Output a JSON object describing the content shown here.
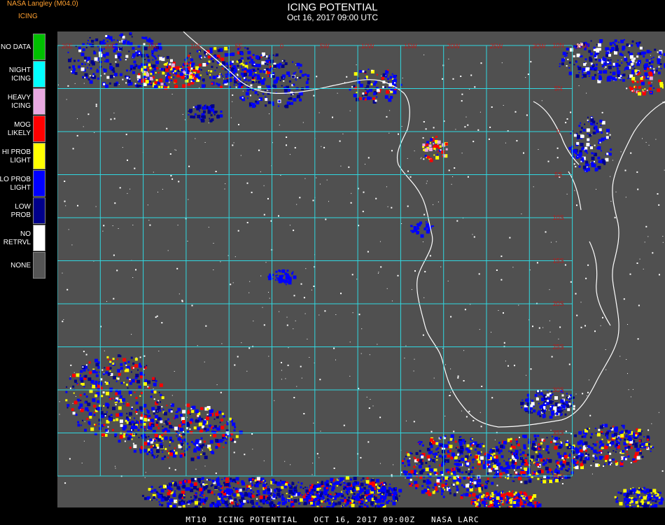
{
  "header": {
    "brand": "NASA Langley (M04.0)",
    "product_short": "ICING",
    "title": "ICING POTENTIAL",
    "subtitle": "Oct 16, 2017 09:00 UTC"
  },
  "legend": [
    {
      "label_lines": [
        "NO DATA"
      ],
      "color": "#00c000"
    },
    {
      "label_lines": [
        "NIGHT",
        "ICING"
      ],
      "color": "#00ffff"
    },
    {
      "label_lines": [
        "HEAVY",
        "ICING"
      ],
      "color": "#e8a8e0"
    },
    {
      "label_lines": [
        "MOG",
        "LIKELY"
      ],
      "color": "#ff0000"
    },
    {
      "label_lines": [
        "HI PROB",
        "LIGHT"
      ],
      "color": "#ffff00"
    },
    {
      "label_lines": [
        "LO PROB",
        "LIGHT"
      ],
      "color": "#0000ff"
    },
    {
      "label_lines": [
        "LOW",
        "PROB"
      ],
      "color": "#00008b"
    },
    {
      "label_lines": [
        "NO",
        "RETRVL"
      ],
      "color": "#ffffff"
    },
    {
      "label_lines": [
        "NONE"
      ],
      "color": "#555555"
    }
  ],
  "map": {
    "background": "#505050",
    "grid_color": "#30d8e0",
    "coast_color": "#ffffff",
    "label_color": "#c01818",
    "longitude_labels": [
      "25E",
      "20E",
      "15E",
      "10E",
      "5E",
      "0",
      "5W",
      "10W",
      "15W",
      "20W",
      "25W",
      "30W",
      "35W"
    ],
    "latitude_labels": [
      "10N",
      "5N",
      "0",
      "5S",
      "10S",
      "15S",
      "20S",
      "25S",
      "30S",
      "35S",
      "40S"
    ]
  },
  "footer": {
    "text": "MT10  ICING POTENTIAL   OCT 16, 2017 09:00Z   NASA LARC"
  }
}
